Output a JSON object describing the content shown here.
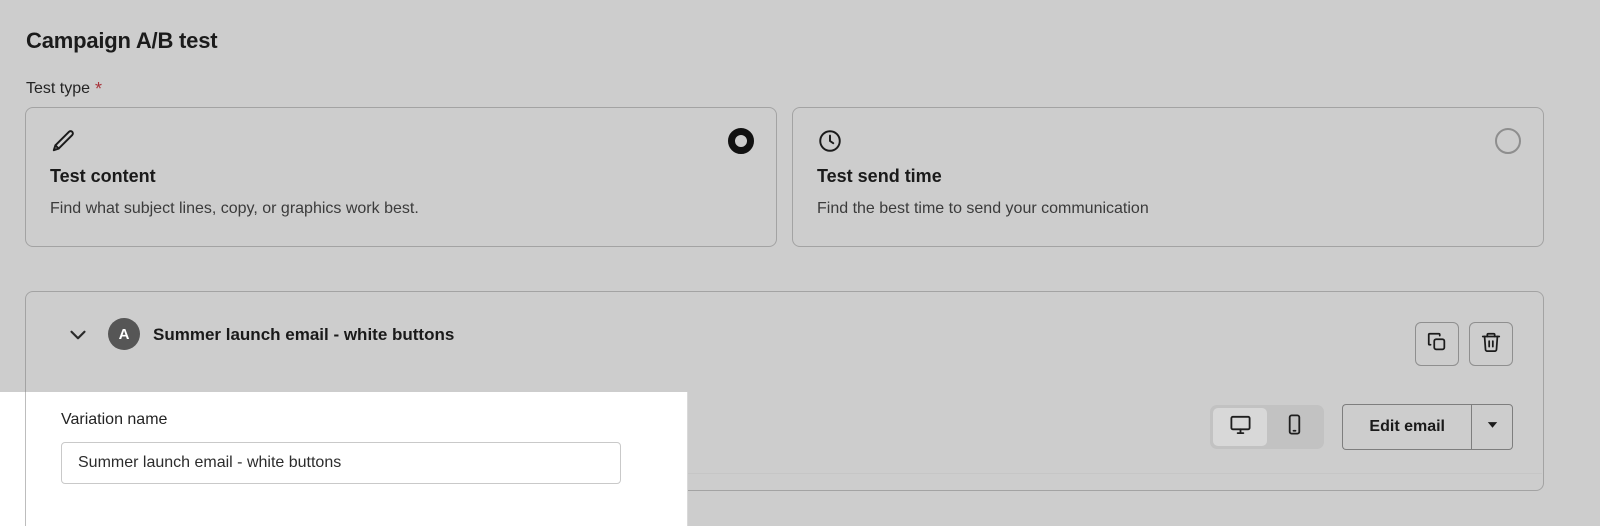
{
  "page": {
    "title": "Campaign A/B test",
    "field_label": "Test type",
    "required_marker": "*"
  },
  "test_type": {
    "options": [
      {
        "id": "test-content",
        "icon": "pencil-icon",
        "title": "Test content",
        "description": "Find what subject lines, copy, or graphics work best.",
        "selected": true
      },
      {
        "id": "test-send-time",
        "icon": "clock-icon",
        "title": "Test send time",
        "description": "Find the best time to send your communication",
        "selected": false
      }
    ]
  },
  "variation": {
    "badge": "A",
    "title": "Summer launch email - white buttons",
    "collapse_icon": "chevron-down-icon",
    "actions": [
      {
        "id": "duplicate",
        "icon": "duplicate-icon",
        "label": "Duplicate variation"
      },
      {
        "id": "delete",
        "icon": "trash-icon",
        "label": "Delete variation"
      }
    ],
    "preview_toolbar": {
      "devices": [
        {
          "id": "desktop",
          "icon": "desktop-icon",
          "active": true
        },
        {
          "id": "mobile",
          "icon": "mobile-icon",
          "active": false
        }
      ],
      "edit_button_label": "Edit email",
      "edit_caret_icon": "caret-down-icon"
    }
  },
  "overlay": {
    "label": "Variation name",
    "input_value": "Summer launch email - white buttons",
    "input_placeholder": "Variation name"
  },
  "colors": {
    "page_background": "#cdcdcd",
    "panel_background": "#ffffff",
    "border": "#a3a3a3",
    "text_primary": "#1a1a1a",
    "text_secondary": "#3b3b3b",
    "required_star": "#a8333a",
    "badge_background": "#565656"
  }
}
